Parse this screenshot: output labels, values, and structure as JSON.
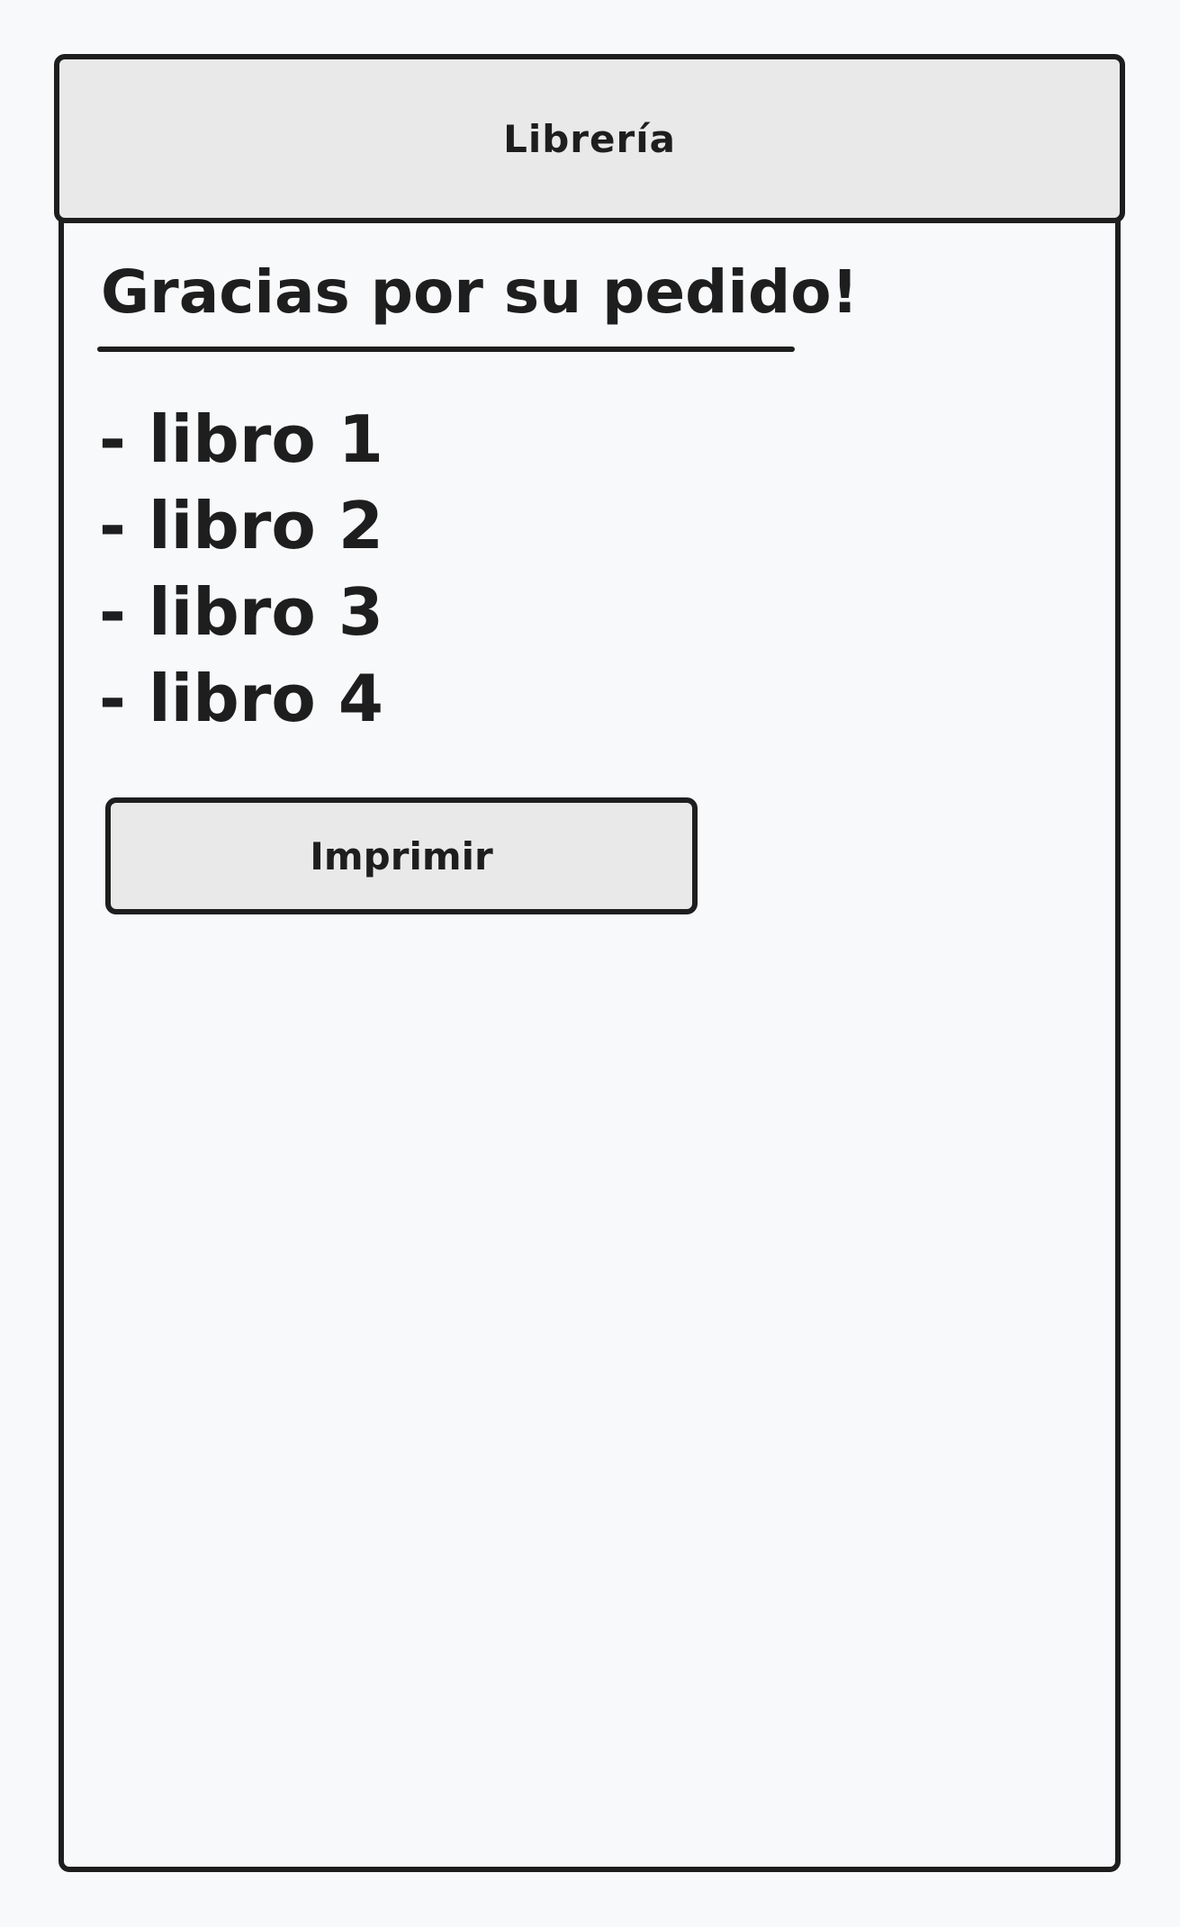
{
  "header": {
    "title": "Librería"
  },
  "main": {
    "title": "Gracias por su pedido!",
    "books": [
      "- libro 1",
      "- libro 2",
      "- libro 3",
      "- libro 4"
    ],
    "print_button_label": "Imprimir"
  },
  "colors": {
    "background": "#f8f9fb",
    "stroke": "#1e1e1e",
    "header_fill": "#e9e9e9",
    "button_fill": "#e9e9e9"
  }
}
